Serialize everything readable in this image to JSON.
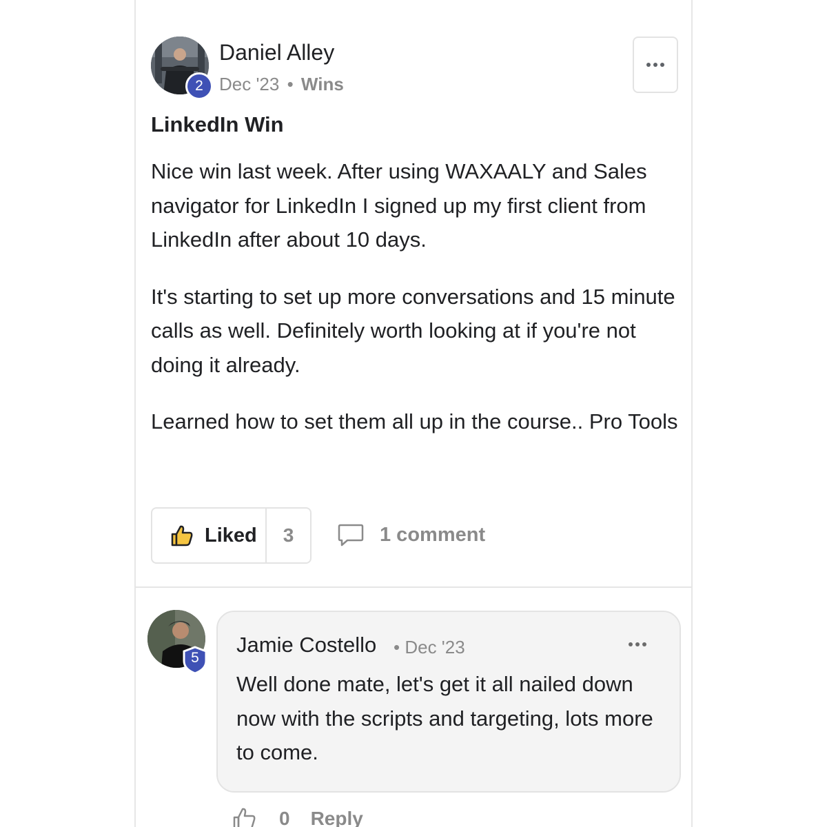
{
  "post": {
    "author": "Daniel Alley",
    "author_level": "2",
    "date": "Dec '23",
    "separator": "•",
    "category": "Wins",
    "title": "LinkedIn Win",
    "paragraphs": [
      "Nice win last week. After using WAXAALY and Sales navigator for LinkedIn I signed up my first client from LinkedIn after about 10 days.",
      "It's starting to set up more conversations and 15 minute calls as well. Definitely worth looking at if you're not doing it already.",
      "Learned how to set them all up in the course.. Pro Tools"
    ],
    "like_label": "Liked",
    "like_count": "3",
    "comment_count": "1 comment"
  },
  "comment": {
    "author": "Jamie Costello",
    "author_level": "5",
    "separator": "•",
    "date": "Dec '23",
    "text": "Well done mate, let's get it all nailed down now with the scripts and targeting, lots more to come.",
    "like_count": "0",
    "reply_label": "Reply"
  },
  "colors": {
    "level_badge": "#3f51b5",
    "liked_thumb": "#f5c542",
    "muted_text": "#8a8a8a",
    "border": "#e3e3e3"
  }
}
